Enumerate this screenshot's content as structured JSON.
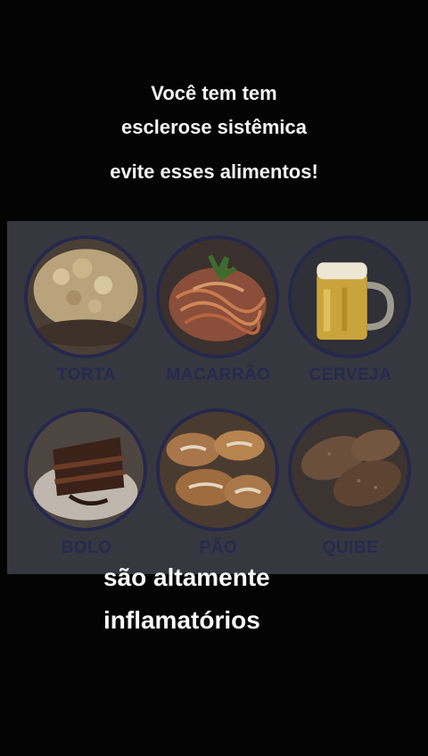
{
  "caption": {
    "line1": "Você tem tem",
    "line2": "esclerose  sistêmica",
    "line3": "evite esses alimentos!"
  },
  "foods": [
    {
      "label": "TORTA",
      "icon": "torta-image"
    },
    {
      "label": "MACARRÃO",
      "icon": "macarrao-image"
    },
    {
      "label": "CERVEJA",
      "icon": "cerveja-image"
    },
    {
      "label": "BOLO",
      "icon": "bolo-image"
    },
    {
      "label": "PÃO",
      "icon": "pao-image"
    },
    {
      "label": "QUIBE",
      "icon": "quibe-image"
    }
  ],
  "bottom": {
    "line1": "são altamente",
    "line2": "inflamatórios"
  }
}
